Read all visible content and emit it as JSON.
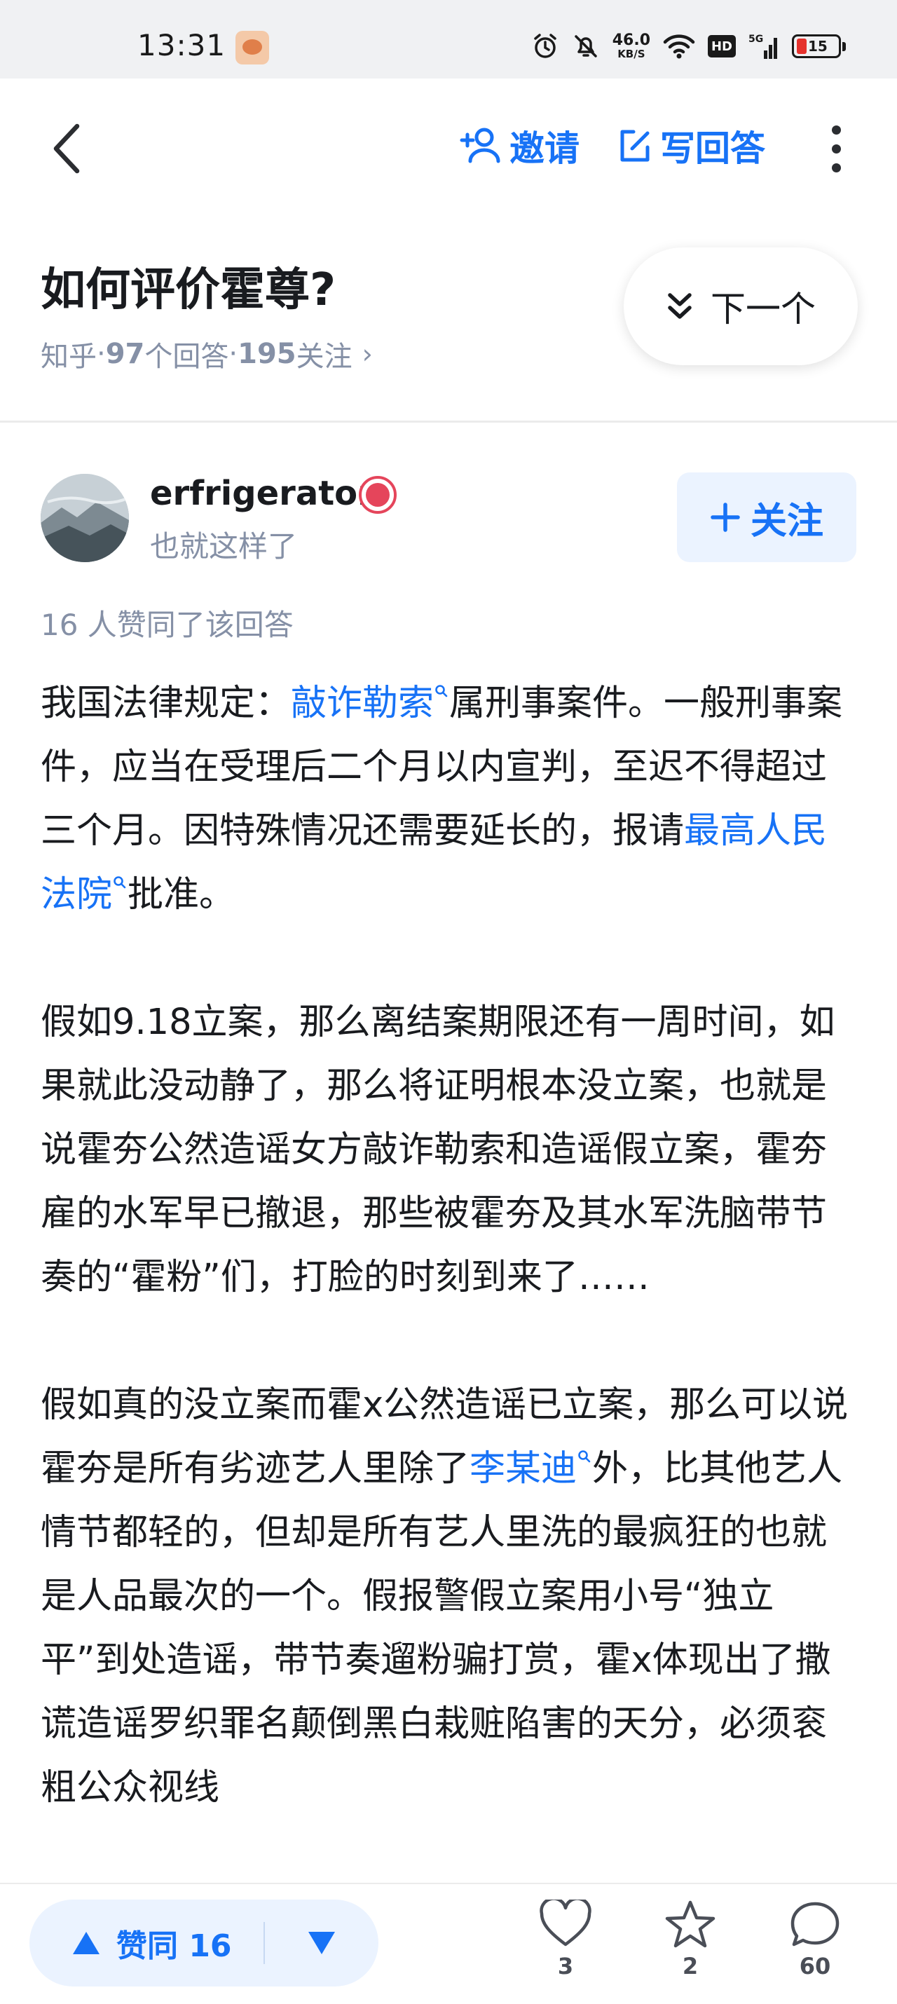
{
  "status_bar": {
    "time": "13:31",
    "net_speed": "46.0",
    "net_unit": "KB/S",
    "hd_label": "HD",
    "signal_label": "5G",
    "battery": "15",
    "colors": {
      "battery_low": "#e5322d"
    }
  },
  "nav": {
    "back_icon": "chevron-left-icon",
    "invite_label": "邀请",
    "answer_label": "写回答",
    "more_icon": "more-vertical-icon",
    "accent": "#1772f6"
  },
  "question": {
    "title": "如何评价霍尊?",
    "source": "知乎",
    "answers_count": "97",
    "answers_suffix": " 个回答",
    "followers_count": "195",
    "followers_suffix": " 关注",
    "sep": "·",
    "chevron": "›",
    "next_label": "下一个"
  },
  "author": {
    "name": "erfrigerator",
    "bio": "也就这样了",
    "follow_label": "关注",
    "likes_text": "16 人赞同了该回答"
  },
  "article": {
    "p1": {
      "a": "我国法律规定：",
      "link1": "敲诈勒索",
      "b": "属刑事案件。一般刑事案件，应当在受理后二个月以内宣判，至迟不得超过三个月。因特殊情况还需要延长的，报请",
      "link2": "最高人民法院",
      "c": "批准。"
    },
    "p2": "假如9.18立案，那么离结案期限还有一周时间，如果就此没动静了，那么将证明根本没立案，也就是说霍夯公然造谣女方敲诈勒索和造谣假立案，霍夯雇的水军早已撤退，那些被霍夯及其水军洗脑带节奏的“霍粉”们，打脸的时刻到来了……",
    "p3": {
      "a": "假如真的没立案而霍x公然造谣已立案，那么可以说霍夯是所有劣迹艺人里除了",
      "link": "李某迪",
      "b": "外，比其他艺人情节都轻的，但却是所有艺人里洗的最疯狂的也就是人品最次的一个。假报警假立案用小号“独立平”到处造谣，带节奏遛粉骗打赏，霍x体现出了撒谎造谣罗织罪名颠倒黑白栽赃陷害的天分，必须衮粗公众视线"
    }
  },
  "bottom_bar": {
    "vote_label": "赞同 16",
    "like_count": "3",
    "favorite_count": "2",
    "comment_count": "60"
  }
}
